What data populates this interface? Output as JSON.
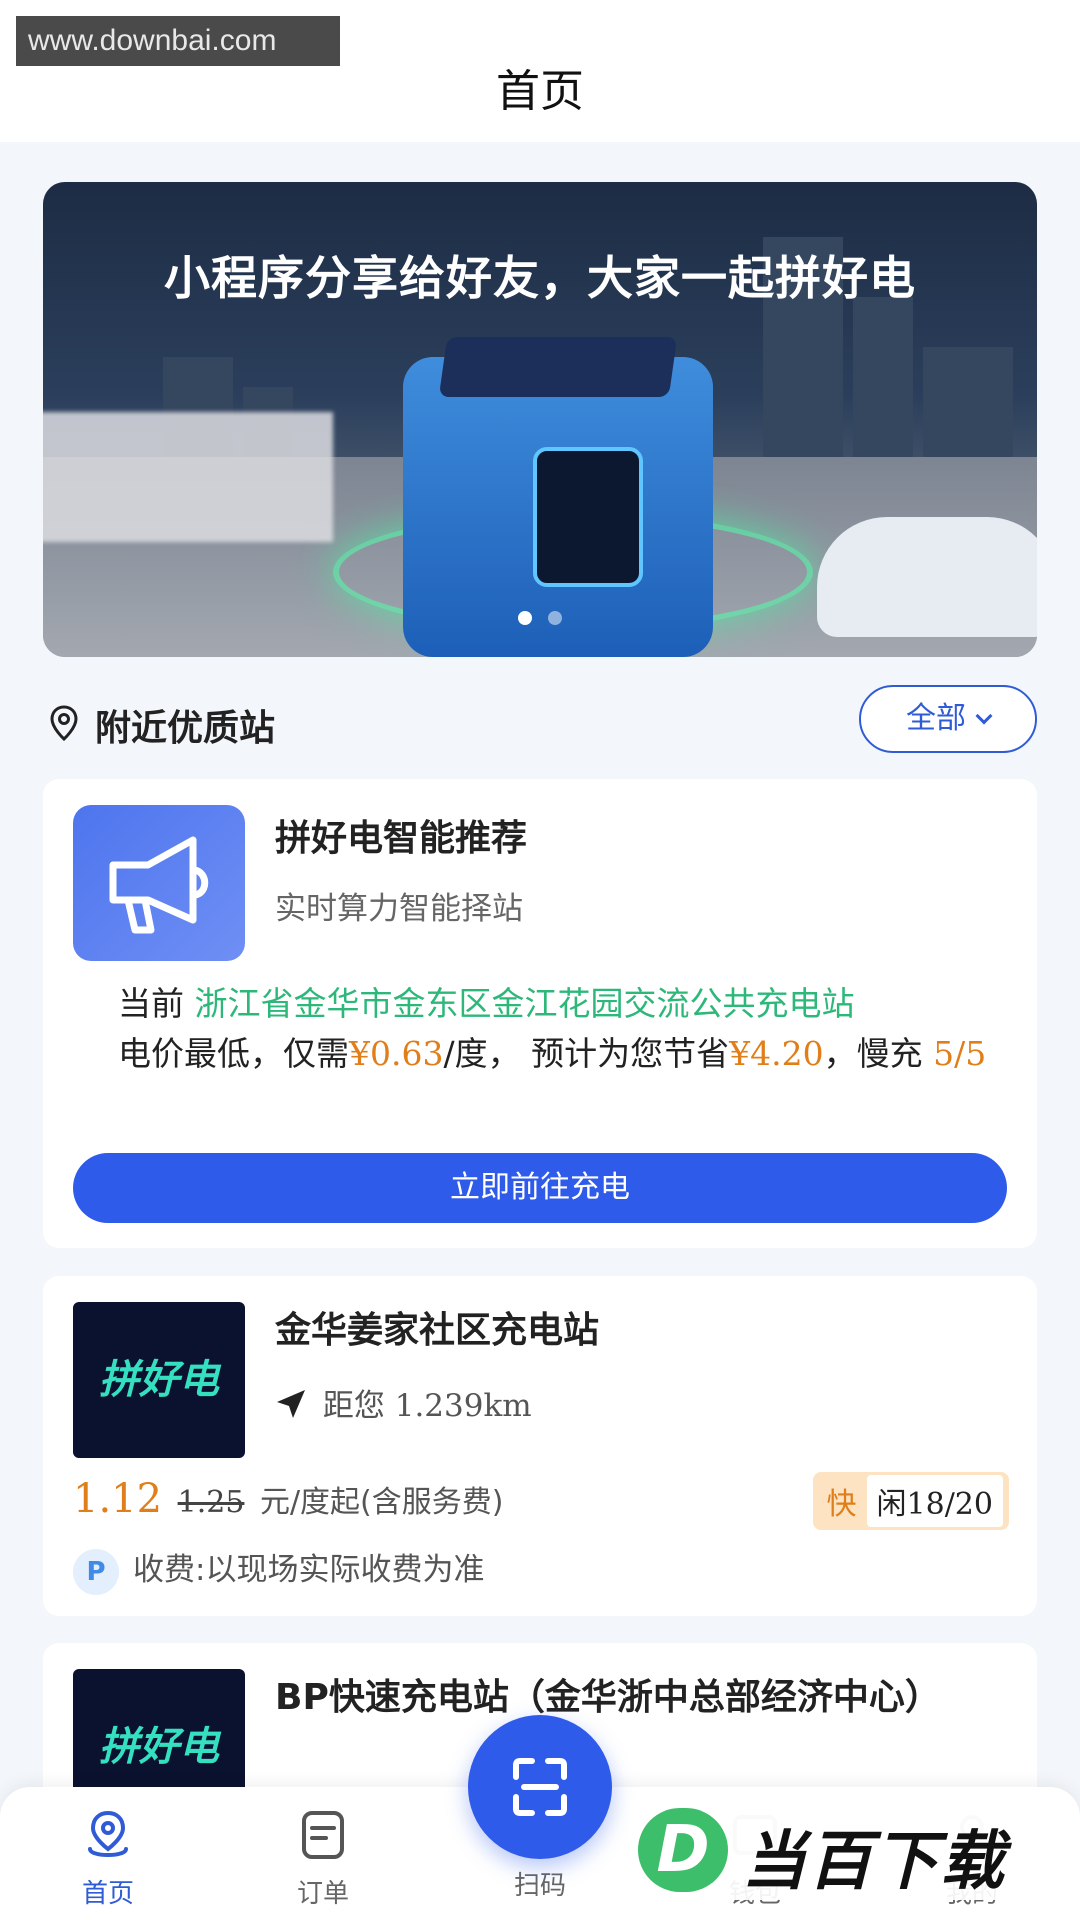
{
  "watermark_top": "www.downbai.com",
  "header": {
    "title": "首页"
  },
  "banner": {
    "headline": "小程序分享给好友，大家一起拼好电",
    "slide_count": 2,
    "active_slide": 1
  },
  "nearby": {
    "title": "附近优质站",
    "filter_label": "全部"
  },
  "recommend": {
    "title": "拼好电智能推荐",
    "subtitle": "实时算力智能择站",
    "prefix_current": "当前",
    "station": "浙江省金华市金东区金江花园交流公共充电站",
    "text_price_lead": "电价最低，仅需",
    "price": "¥0.63",
    "text_unit": "/度，",
    "text_save_lead": "预计为您节省",
    "save": "¥4.20",
    "text_slow": "，慢充",
    "slow_count": "5/5",
    "button": "立即前往充电"
  },
  "stations": [
    {
      "logo": "拼好电",
      "name": "金华姜家社区充电站",
      "distance_label": "距您",
      "distance": "1.239km",
      "price": "1.12",
      "old_price": "1.25",
      "price_unit": "元/度起(含服务费)",
      "speed_tag": "快",
      "availability": "闲18/20",
      "fee_icon": "P",
      "fee_text": "收费:以现场实际收费为准"
    },
    {
      "logo": "拼好电",
      "name": "BP快速充电站（金华浙中总部经济中心）"
    }
  ],
  "tabbar": {
    "home": "首页",
    "order": "订单",
    "scan": "扫码",
    "wallet": "钱包",
    "mine": "我的"
  },
  "watermark_bottom": {
    "letter": "D",
    "text": "当百下载"
  },
  "colors": {
    "primary": "#2f5bea",
    "accent_orange": "#e07f1a",
    "accent_green": "#2db87a"
  }
}
